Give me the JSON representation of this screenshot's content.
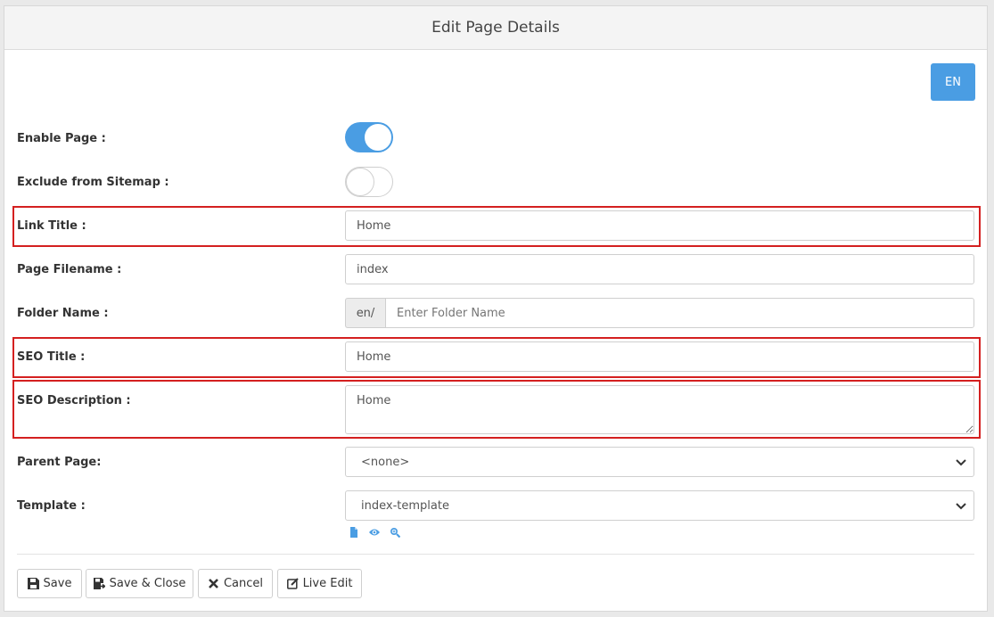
{
  "header": {
    "title": "Edit Page Details"
  },
  "language_button": "EN",
  "fields": {
    "enable_page": {
      "label": "Enable Page :",
      "on": true
    },
    "exclude_sitemap": {
      "label": "Exclude from Sitemap :",
      "on": false
    },
    "link_title": {
      "label": "Link Title :",
      "value": "Home"
    },
    "page_filename": {
      "label": "Page Filename :",
      "value": "index"
    },
    "folder_name": {
      "label": "Folder Name :",
      "prefix": "en/",
      "placeholder": "Enter Folder Name",
      "value": ""
    },
    "seo_title": {
      "label": "SEO Title :",
      "value": "Home"
    },
    "seo_description": {
      "label": "SEO Description :",
      "value": "Home"
    },
    "parent_page": {
      "label": "Parent Page:",
      "selected": "<none>"
    },
    "template": {
      "label": "Template :",
      "selected": "index-template"
    }
  },
  "template_icons": [
    "file-icon",
    "eye-icon",
    "zoom-icon"
  ],
  "footer_buttons": {
    "save": "Save",
    "save_close": "Save & Close",
    "cancel": "Cancel",
    "live_edit": "Live Edit"
  },
  "colors": {
    "accent": "#4a9de3",
    "highlight": "#d42020"
  }
}
